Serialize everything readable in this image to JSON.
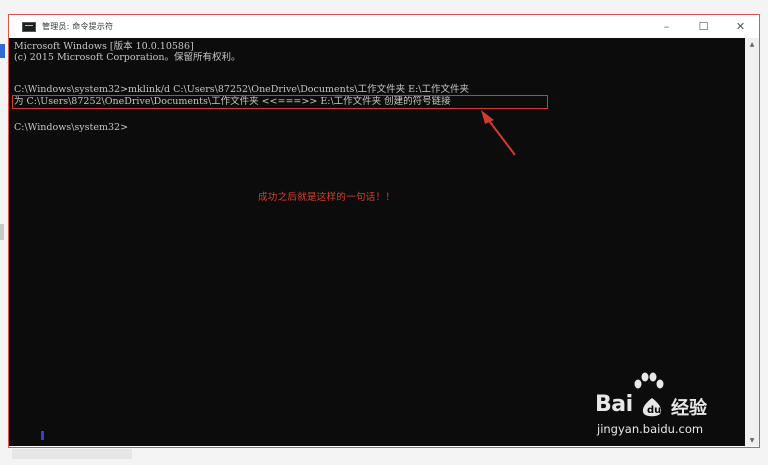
{
  "window": {
    "title": "管理员: 命令提示符",
    "minimize_glyph": "–",
    "maximize_glyph": "☐",
    "close_glyph": "✕"
  },
  "console": {
    "lines": [
      "Microsoft Windows [版本 10.0.10586]",
      "(c) 2015 Microsoft Corporation。保留所有权利。",
      "",
      "C:\\Windows\\system32>mklink/d C:\\Users\\87252\\OneDrive\\Documents\\工作文件夹 E:\\工作文件夹",
      "为 C:\\Users\\87252\\OneDrive\\Documents\\工作文件夹 <<===>> E:\\工作文件夹 创建的符号链接",
      "",
      "C:\\Windows\\system32>"
    ],
    "annotation": "成功之后就是这样的一句话！！"
  },
  "watermark": {
    "brand": "Bai",
    "brand_cn": "经验",
    "url": "jingyan.baidu.com"
  },
  "scrollbar": {
    "up_glyph": "▲",
    "down_glyph": "▼"
  },
  "colors": {
    "console_bg": "#0c0c0c",
    "console_text": "#c6c6c6",
    "annotation_red": "#d8402e",
    "frame_red": "#d35a4a"
  }
}
